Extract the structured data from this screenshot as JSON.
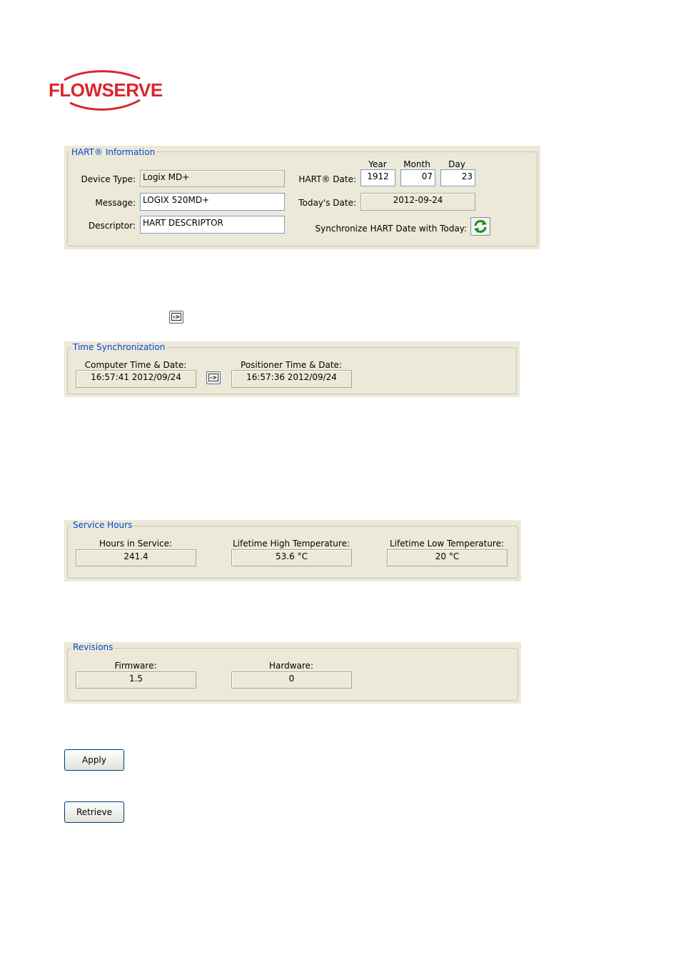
{
  "logo": {
    "text": "FLOWSERVE",
    "color": "#d9262c"
  },
  "hart": {
    "legend": "HART® Information",
    "device_type_label": "Device Type:",
    "device_type_value": "Logix MD+",
    "message_label": "Message:",
    "message_value": "LOGIX 520MD+",
    "descriptor_label": "Descriptor:",
    "descriptor_value": "HART DESCRIPTOR",
    "year_label": "Year",
    "month_label": "Month",
    "day_label": "Day",
    "hart_date_label": "HART® Date:",
    "year_value": "1912",
    "month_value": "07",
    "day_value": "23",
    "todays_date_label": "Today's Date:",
    "todays_date_value": "2012-09-24",
    "sync_label": "Synchronize HART Date with Today:",
    "sync_icon": "refresh-icon"
  },
  "standalone_button": {
    "label": "->"
  },
  "time_sync": {
    "legend": "Time Synchronization",
    "computer_label": "Computer Time & Date:",
    "computer_value": "16:57:41 2012/09/24",
    "copy_button_label": "->",
    "positioner_label": "Positioner Time & Date:",
    "positioner_value": "16:57:36 2012/09/24"
  },
  "service_hours": {
    "legend": "Service Hours",
    "hours_label": "Hours in Service:",
    "hours_value": "241.4",
    "high_label": "Lifetime High Temperature:",
    "high_value": "53.6 °C",
    "low_label": "Lifetime Low Temperature:",
    "low_value": "20 °C"
  },
  "revisions": {
    "legend": "Revisions",
    "firmware_label": "Firmware:",
    "firmware_value": "1.5",
    "hardware_label": "Hardware:",
    "hardware_value": "0"
  },
  "actions": {
    "apply_label": "Apply",
    "retrieve_label": "Retrieve"
  }
}
